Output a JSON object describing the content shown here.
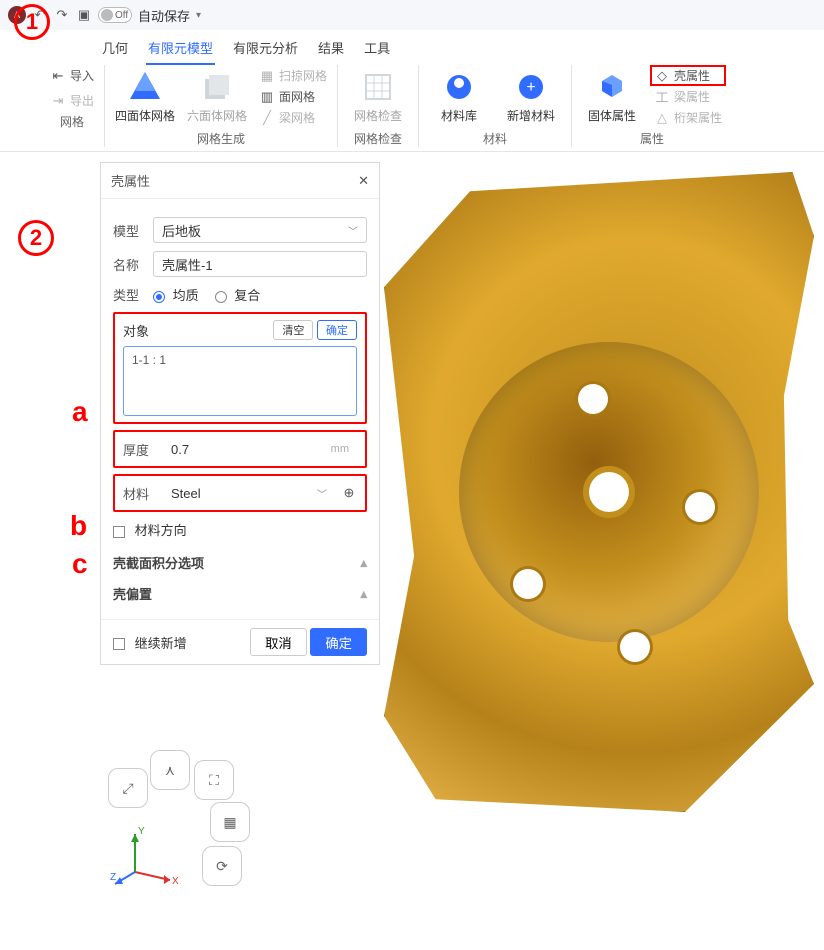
{
  "titlebar": {
    "toggle_label": "Off",
    "autosave": "自动保存"
  },
  "ribbon": {
    "tabs": [
      "几何",
      "有限元模型",
      "有限元分析",
      "结果",
      "工具"
    ],
    "active_tab_index": 1,
    "io": {
      "import": "导入",
      "export": "导出"
    },
    "groups": {
      "mesh": "网格",
      "meshgen": "网格生成",
      "meshcheck": "网格检查",
      "materials": "材料",
      "props": "属性"
    },
    "buttons": {
      "tet": "四面体网格",
      "hex": "六面体网格",
      "sweep": "扫掠网格",
      "face": "面网格",
      "beam": "梁网格",
      "meshcheck": "网格检查",
      "matlib": "材料库",
      "addmat": "新增材料",
      "solidprop": "固体属性",
      "shellprop": "壳属性",
      "beamprop": "梁属性",
      "trussprop": "桁架属性"
    }
  },
  "panel": {
    "title": "壳属性",
    "model_label": "模型",
    "model_value": "后地板",
    "name_label": "名称",
    "name_value": "壳属性-1",
    "type_label": "类型",
    "type_options": [
      "均质",
      "复合"
    ],
    "type_selected": "均质",
    "object_label": "对象",
    "clear": "清空",
    "ok_small": "确定",
    "object_item": "1-1 : 1",
    "thickness_label": "厚度",
    "thickness_value": "0.7",
    "thickness_unit": "mm",
    "material_label": "材料",
    "material_value": "Steel",
    "matdir": "材料方向",
    "section_opts": "壳截面积分选项",
    "offset": "壳偏置",
    "continue_add": "继续新增",
    "cancel": "取消",
    "confirm": "确定"
  },
  "callouts": {
    "n1": "1",
    "n2": "2",
    "a": "a",
    "b": "b",
    "c": "c"
  },
  "axes": {
    "x": "X",
    "y": "Y",
    "z": "Z"
  }
}
